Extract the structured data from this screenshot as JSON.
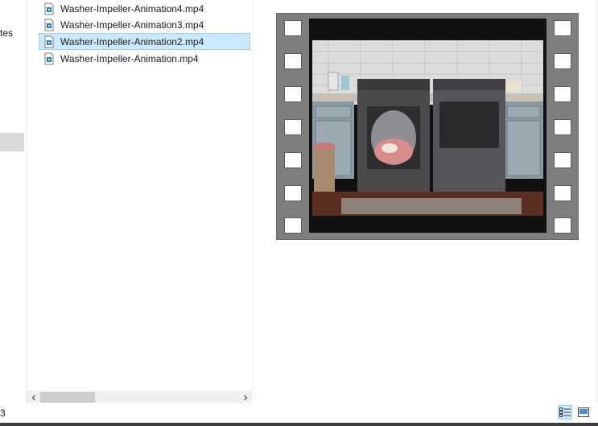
{
  "nav_pane": {
    "fragment_text": "tes"
  },
  "files": [
    {
      "name": "Washer-Impeller-Animation4.mp4",
      "selected": false
    },
    {
      "name": "Washer-Impeller-Animation3.mp4",
      "selected": false
    },
    {
      "name": "Washer-Impeller-Animation2.mp4",
      "selected": true
    },
    {
      "name": "Washer-Impeller-Animation.mp4",
      "selected": false
    }
  ],
  "file_icon": "video-file-icon",
  "scrollbar": {
    "left_arrow": "‹",
    "right_arrow": "›"
  },
  "status_bar": {
    "count_fragment": "3",
    "details_view_icon": "details-view-icon",
    "tiles_view_icon": "large-icons-view-icon"
  },
  "colors": {
    "selection_fill": "#cce8ff",
    "selection_border": "#99d1ff",
    "film_gray": "#7f7f7f"
  }
}
